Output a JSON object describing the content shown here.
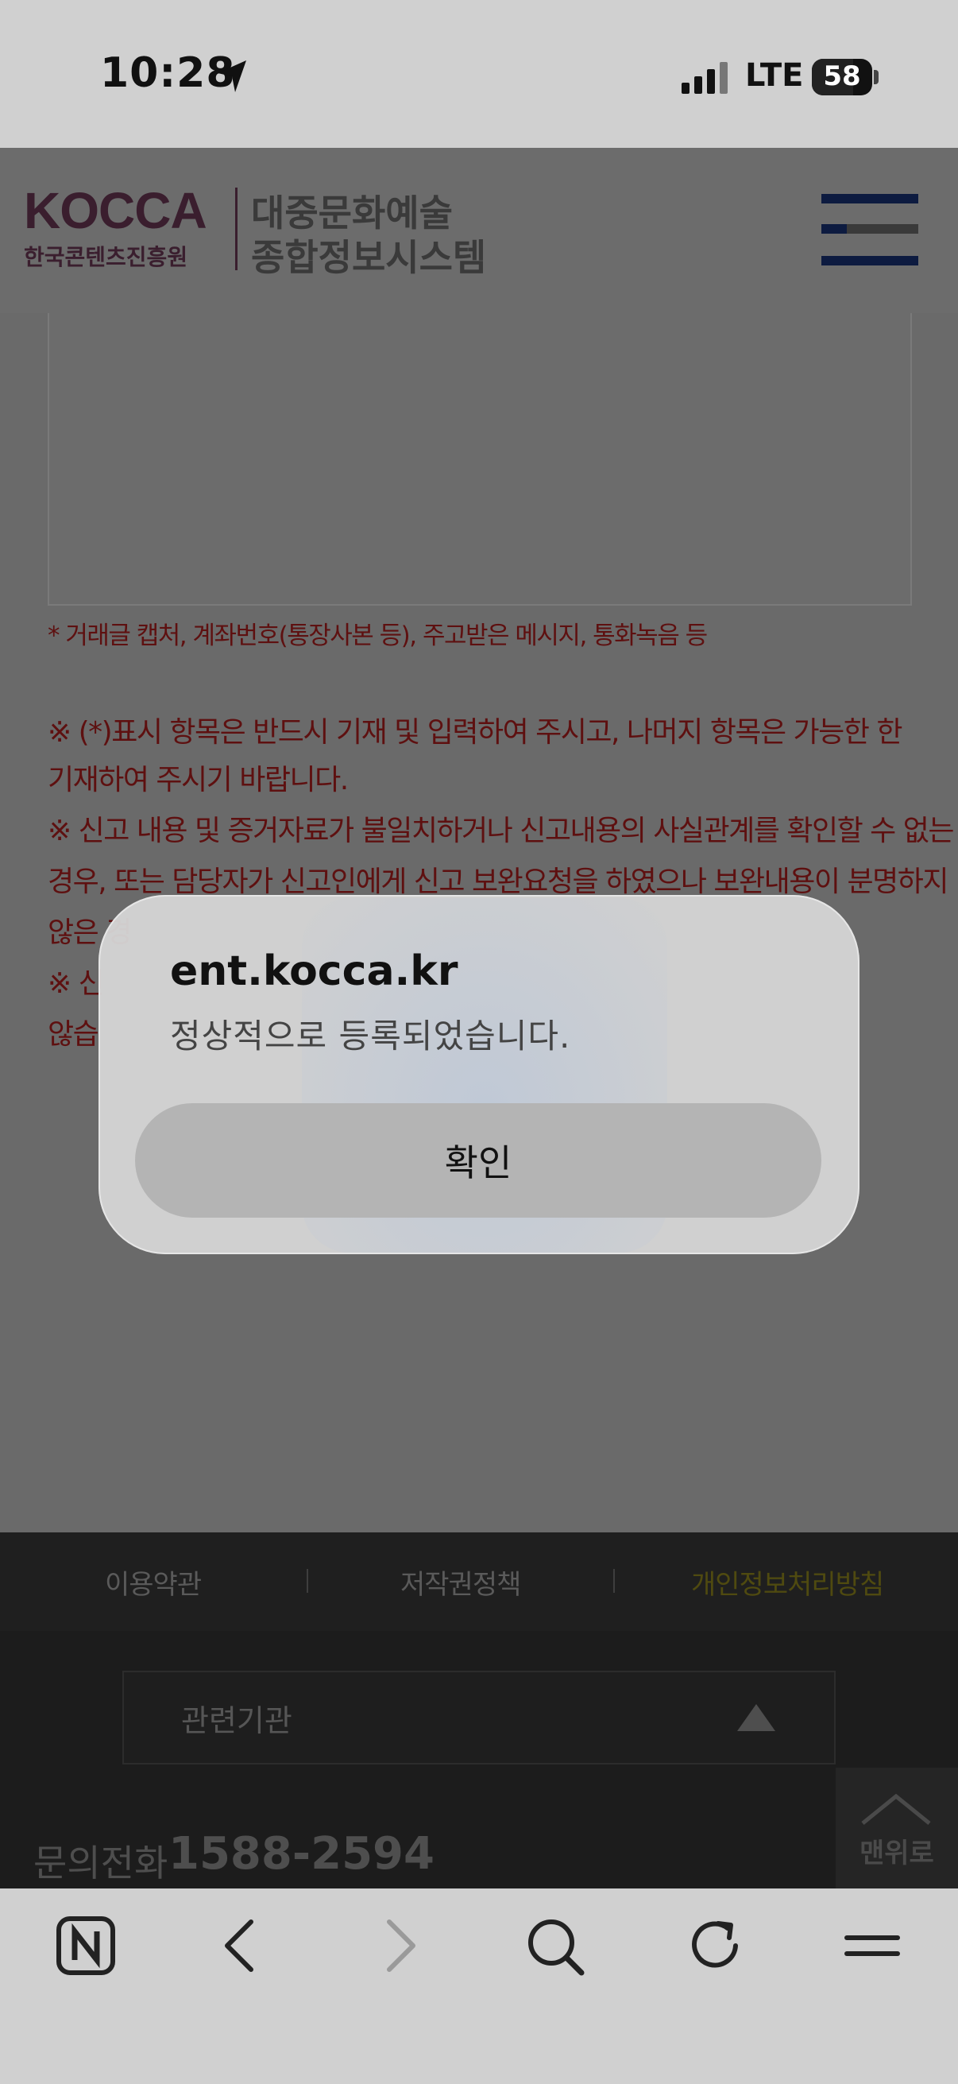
{
  "status_bar": {
    "time": "10:28",
    "network": "LTE",
    "battery": "58",
    "icons": [
      "location-arrow-icon",
      "cellular-signal-icon",
      "battery-icon"
    ]
  },
  "header": {
    "logo_brand": "KOCCA",
    "logo_org": "한국콘텐츠진흥원",
    "logo_title_line1": "대중문화예술",
    "logo_title_line2": "종합정보시스템",
    "menu_icon": "hamburger-menu-icon"
  },
  "content": {
    "evidence_note": "* 거래글 캡처, 계좌번호(통장사본 등), 주고받은 메시지, 통화녹음 등",
    "notice_lines": [
      "※ (*)표시 항목은 반드시 기재 및 입력하여 주시고, 나머지 항목은 가능한 한",
      "기재하여 주시기 바랍니다.",
      "※ 신고 내용 및 증거자료가 불일치하거나 신고내용의 사실관계를 확인할 수 없는",
      "경우, 또는 담당자가 신고인에게 신고 보완요청을 하였으나 보완내용이 분명하지",
      "않은 경",
      "※ 신",
      "않습"
    ]
  },
  "dialog": {
    "title": "ent.kocca.kr",
    "message": "정상적으로 등록되었습니다.",
    "confirm_label": "확인"
  },
  "footer": {
    "links": [
      "이용약관",
      "저작권정책",
      "개인정보처리방침"
    ],
    "related_label": "관련기관",
    "phone_label": "문의전화",
    "phone_number": "1588-2594",
    "top_label": "맨위로",
    "colors": {
      "privacy_link": "#4f4a10"
    }
  },
  "toolbar": {
    "icons": [
      "naver-home-icon",
      "back-icon",
      "forward-icon",
      "search-icon",
      "reload-icon",
      "menu-icon"
    ]
  }
}
